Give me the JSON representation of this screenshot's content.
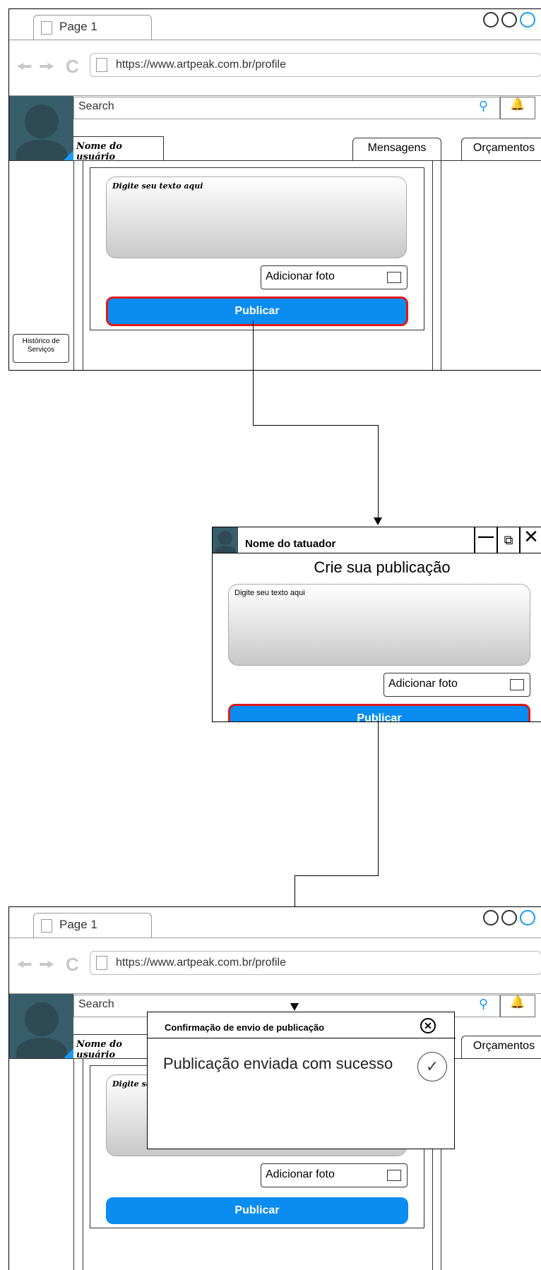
{
  "browser": {
    "tab_label": "Page 1",
    "url": "https://www.artpeak.com.br/profile",
    "search_placeholder": "Search"
  },
  "profile": {
    "username": "Nome do usuário",
    "tab_messages": "Mensagens",
    "tab_quotes": "Orçamentos",
    "history_button": "Histórico de Serviços",
    "text_placeholder": "Digite seu texto aqui",
    "add_photo": "Adicionar foto",
    "publish": "Publicar"
  },
  "dialog": {
    "author": "Nome do tatuador",
    "title": "Crie sua publicação",
    "text_placeholder": "Digite seu texto aqui",
    "add_photo": "Adicionar foto",
    "publish": "Publicar",
    "minimize_icon": "minimize-icon",
    "restore_icon": "restore-icon",
    "close_icon": "close-icon"
  },
  "confirmation": {
    "title": "Confirmação de envio de publicação",
    "message": "Publicação enviada com sucesso",
    "close_icon": "close-circle-icon",
    "success_icon": "check-circle-icon"
  },
  "colors": {
    "accent": "#0a8cf0",
    "highlight_border": "#e01818",
    "avatar_bg": "#385d6b"
  }
}
